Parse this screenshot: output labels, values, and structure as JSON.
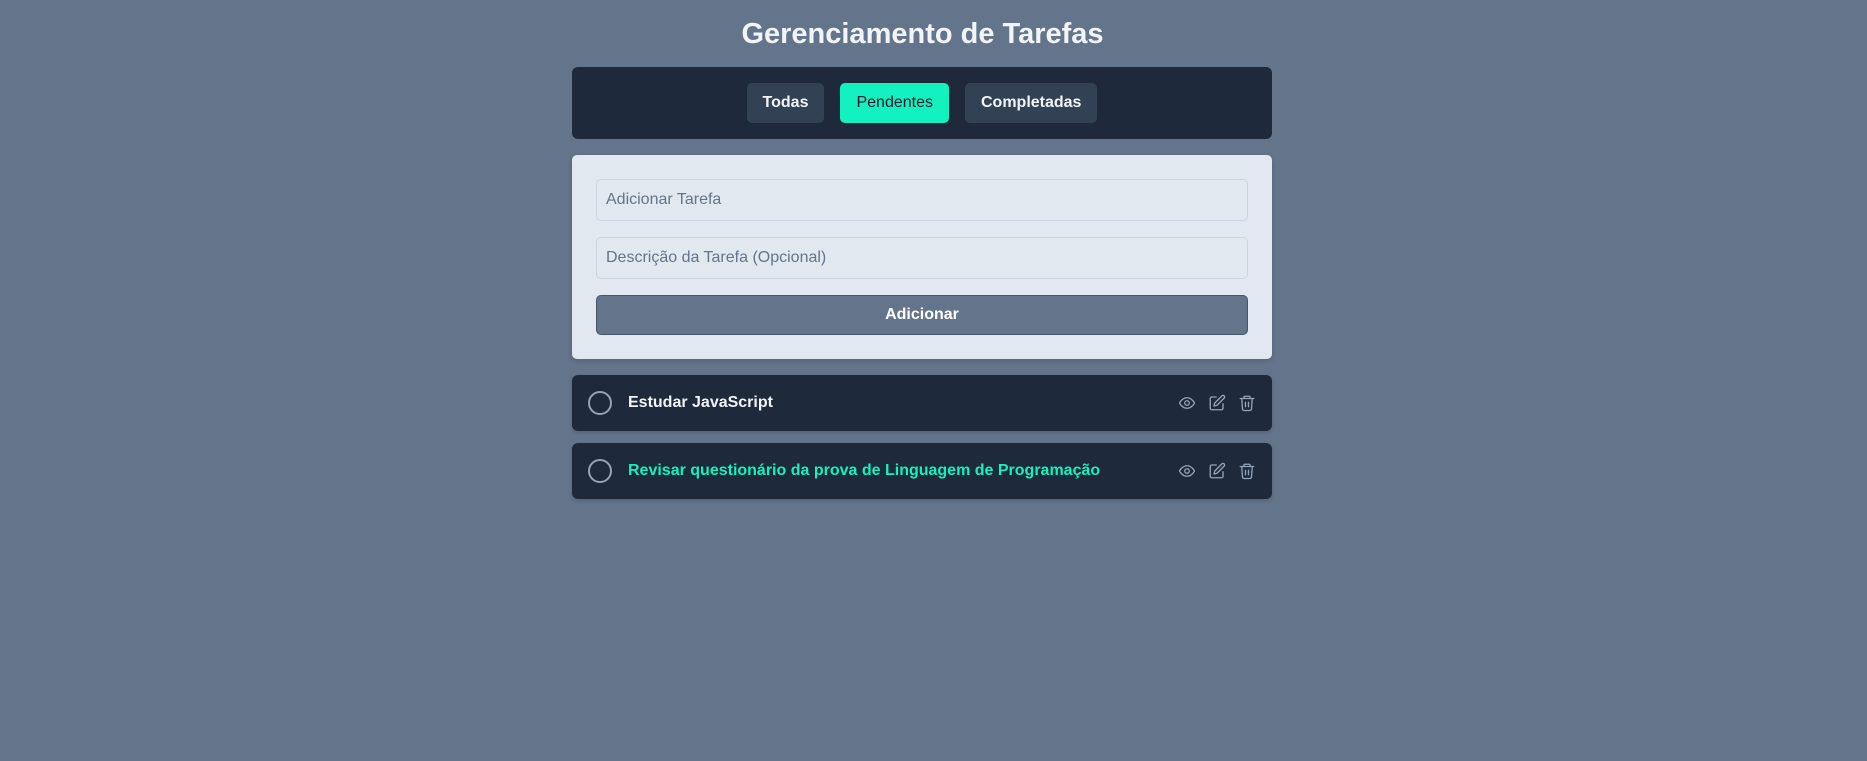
{
  "header": {
    "title": "Gerenciamento de Tarefas"
  },
  "filters": {
    "items": [
      {
        "label": "Todas",
        "active": false
      },
      {
        "label": "Pendentes",
        "active": true
      },
      {
        "label": "Completadas",
        "active": false
      }
    ]
  },
  "form": {
    "title_placeholder": "Adicionar Tarefa",
    "title_value": "",
    "description_placeholder": "Descrição da Tarefa (Opcional)",
    "description_value": "",
    "add_label": "Adicionar"
  },
  "tasks": [
    {
      "title": "Estudar JavaScript",
      "completed": false,
      "actions": [
        "eye-icon",
        "edit-icon",
        "trash-icon"
      ]
    },
    {
      "title": "Revisar questionário da prova de Linguagem de Programação",
      "completed": false,
      "actions": [
        "eye-icon",
        "edit-icon",
        "trash-icon"
      ]
    }
  ],
  "colors": {
    "background": "#64748b",
    "panel": "#1e293b",
    "accent": "#14f1c0",
    "form_card": "#e2e8f0",
    "button_inactive": "#334155"
  }
}
